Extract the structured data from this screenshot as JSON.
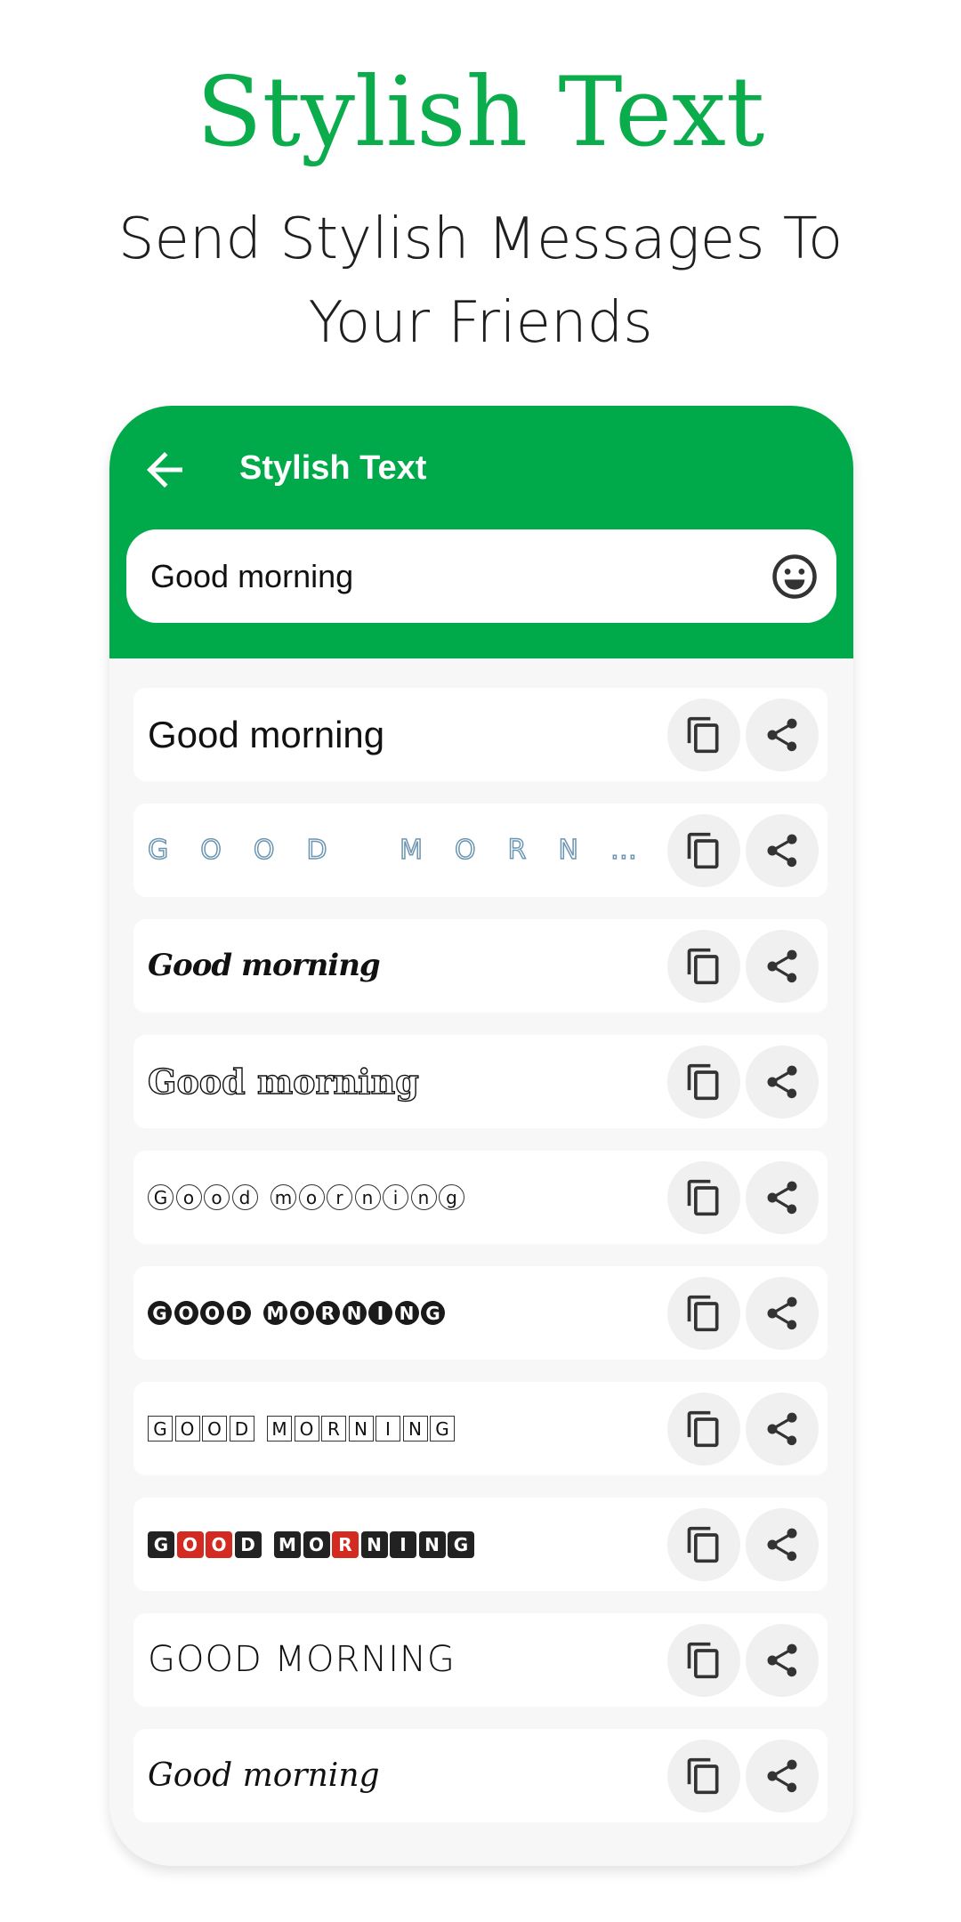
{
  "promo": {
    "title": "Stylish Text",
    "subtitle_line1": "Send Stylish Messages To",
    "subtitle_line2": "Your Friends"
  },
  "app": {
    "title": "Stylish Text",
    "back_icon": "arrow-left-icon",
    "search": {
      "value": "Good morning",
      "emoji_icon": "smiley-icon"
    },
    "accent_color": "#00aa4b"
  },
  "styles": [
    {
      "text": "Good morning",
      "style": "plain"
    },
    {
      "text": "GOOD MORNING",
      "style": "outline"
    },
    {
      "text": "Good morning",
      "style": "script"
    },
    {
      "text": "Good morning",
      "style": "double"
    },
    {
      "text": "Good morning",
      "style": "circle"
    },
    {
      "text": "GOOD MORNING",
      "style": "negcircle"
    },
    {
      "text": "GOOD MORNING",
      "style": "square"
    },
    {
      "text": "GOOD MORNING",
      "style": "negsq",
      "red_letter_indices": [
        1,
        2,
        6
      ]
    },
    {
      "text": "GOOD MORNING",
      "style": "thin"
    },
    {
      "text": "Good morning",
      "style": "goth"
    }
  ],
  "row_actions": {
    "copy_icon": "copy-icon",
    "share_icon": "share-icon"
  }
}
